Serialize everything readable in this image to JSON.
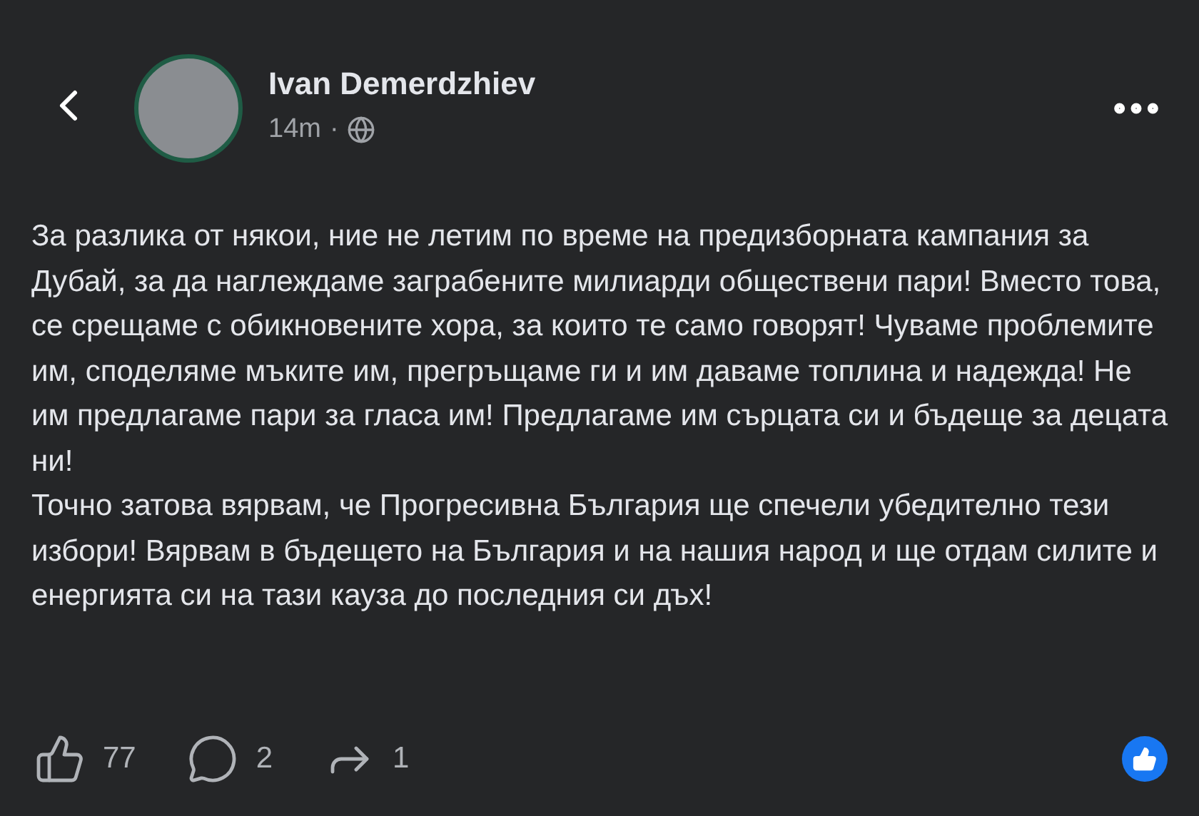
{
  "post": {
    "author": "Ivan Demerdzhiev",
    "time": "14m",
    "separator": "·",
    "paragraphs": [
      "За разлика от някои, ние не летим по време на предизборната кампания за Дубай, за да наглеждаме заграбените милиарди обществени пари! Вместо това, се срещаме с обикновените хора, за които те само говорят! Чуваме проблемите им, споделяме мъките им, прегръщаме ги и им даваме топлина и надежда! Не им предлагаме пари за гласа им! Предлагаме им сърцата си и бъдеще за децата ни!",
      "Точно затова вярвам, че Прогресивна България ще спечели убедително тези избори! Вярвам в бъдещето на България и на нашия народ и ще отдам силите и енергията си на тази кауза до последния си дъх!"
    ]
  },
  "actions": [
    {
      "kind": "like",
      "count": "77"
    },
    {
      "kind": "comment",
      "count": "2"
    },
    {
      "kind": "share",
      "count": "1"
    }
  ]
}
